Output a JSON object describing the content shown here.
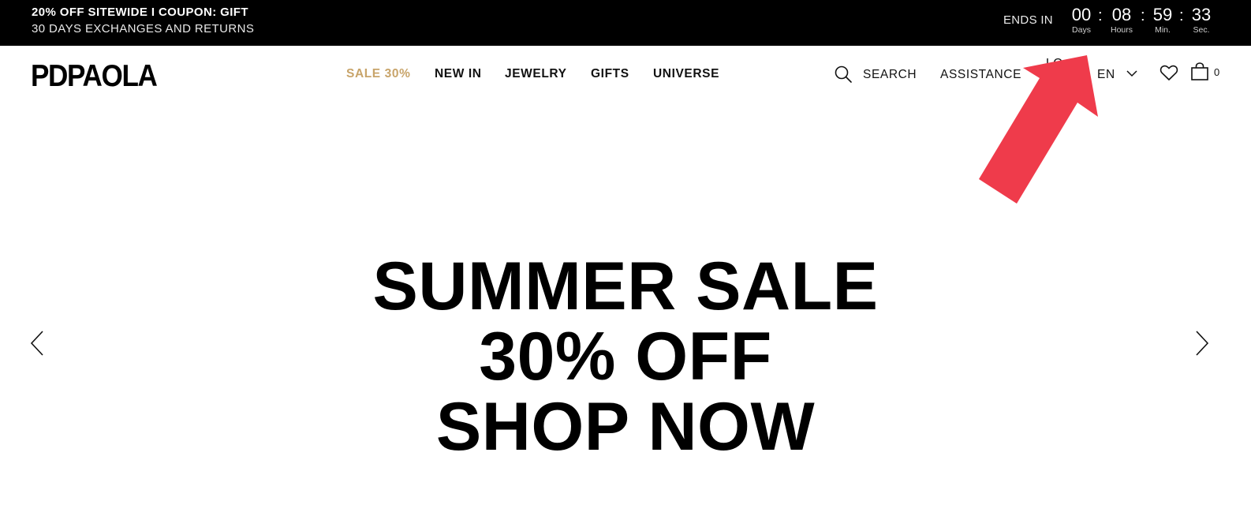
{
  "topbar": {
    "promo_primary": "20% OFF SITEWIDE I COUPON: GIFT",
    "promo_secondary": "30 DAYS EXCHANGES AND RETURNS",
    "ends_in_label": "ENDS IN",
    "countdown": [
      {
        "value": "00",
        "label": "Days"
      },
      {
        "value": "08",
        "label": "Hours"
      },
      {
        "value": "59",
        "label": "Min."
      },
      {
        "value": "33",
        "label": "Sec."
      }
    ],
    "separator": ":"
  },
  "header": {
    "logo": "PDPAOLA",
    "nav": [
      {
        "label": "SALE 30%"
      },
      {
        "label": "NEW IN"
      },
      {
        "label": "JEWELRY"
      },
      {
        "label": "GIFTS"
      },
      {
        "label": "UNIVERSE"
      }
    ],
    "search_label": "SEARCH",
    "assistance_label": "ASSISTANCE",
    "login_partial": "LO",
    "language": "EN",
    "cart_count": "0",
    "icons": {
      "search": "search-icon",
      "language_dropdown": "chevron-down-icon",
      "wishlist": "heart-icon",
      "cart": "bag-icon"
    }
  },
  "hero": {
    "line1": "SUMMER SALE",
    "line2": "30% OFF",
    "line3": "SHOP NOW",
    "prev_icon": "chevron-left-icon",
    "next_icon": "chevron-right-icon"
  },
  "colors": {
    "topbar_bg": "#000000",
    "sale_accent": "#c8a46a",
    "annotation_arrow": "#ef3b4b"
  }
}
